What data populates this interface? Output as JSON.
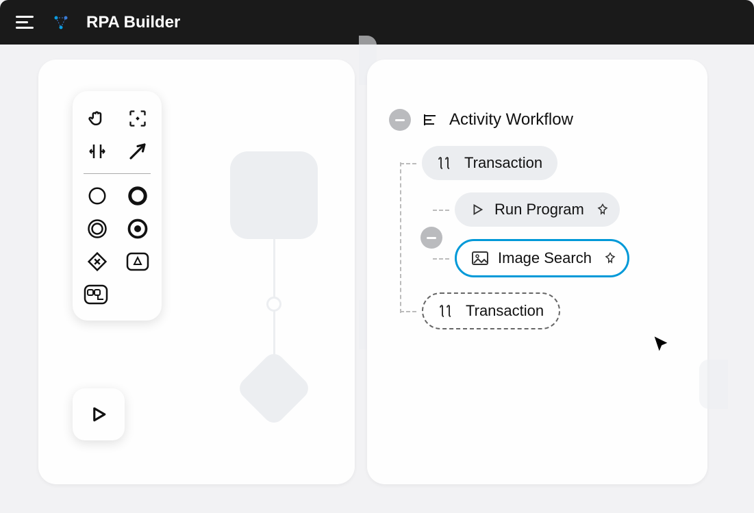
{
  "header": {
    "title": "RPA Builder"
  },
  "toolbox": {
    "tools": [
      "hand",
      "crop",
      "align",
      "arrow",
      "circle",
      "circle-bold",
      "ring",
      "target",
      "diamond-x",
      "triangle-box",
      "panel"
    ]
  },
  "workflow": {
    "title": "Activity Workflow",
    "items": [
      {
        "label": "Transaction",
        "type": "transaction"
      },
      {
        "label": "Run Program",
        "type": "action",
        "pinned": true
      },
      {
        "label": "Image Search",
        "type": "image",
        "pinned": true,
        "selected": true
      },
      {
        "label": "Transaction",
        "type": "transaction-dashed"
      }
    ]
  }
}
